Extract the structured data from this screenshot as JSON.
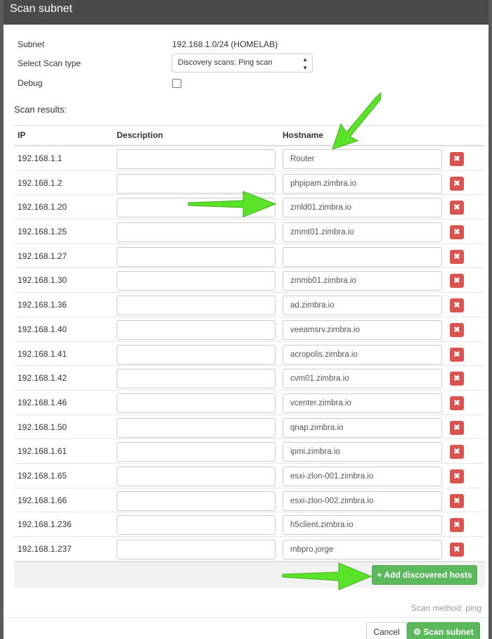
{
  "header": {
    "title": "Scan subnet"
  },
  "info": {
    "subnet_label": "Subnet",
    "subnet_value": "192.168.1.0/24 (HOMELAB)",
    "scan_type_label": "Select Scan type",
    "scan_type_value": "Discovery scans: Ping scan",
    "debug_label": "Debug"
  },
  "results_label": "Scan results:",
  "table": {
    "columns": [
      "IP",
      "Description",
      "Hostname"
    ],
    "rows": [
      {
        "ip": "192.168.1.1",
        "hostname": "Router"
      },
      {
        "ip": "192.168.1.2",
        "hostname": "phpipam.zimbra.io"
      },
      {
        "ip": "192.168.1.20",
        "hostname": "zmld01.zimbra.io"
      },
      {
        "ip": "192.168.1.25",
        "hostname": "zmmt01.zimbra.io"
      },
      {
        "ip": "192.168.1.27",
        "hostname": ""
      },
      {
        "ip": "192.168.1.30",
        "hostname": "zmmb01.zimbra.io"
      },
      {
        "ip": "192.168.1.36",
        "hostname": "ad.zimbra.io"
      },
      {
        "ip": "192.168.1.40",
        "hostname": "veeamsrv.zimbra.io"
      },
      {
        "ip": "192.168.1.41",
        "hostname": "acropolis.zimbra.io"
      },
      {
        "ip": "192.168.1.42",
        "hostname": "cvm01.zimbra.io"
      },
      {
        "ip": "192.168.1.46",
        "hostname": "vcenter.zimbra.io"
      },
      {
        "ip": "192.168.1.50",
        "hostname": "qnap.zimbra.io"
      },
      {
        "ip": "192.168.1.61",
        "hostname": "ipmi.zimbra.io"
      },
      {
        "ip": "192.168.1.65",
        "hostname": "esxi-zlon-001.zimbra.io"
      },
      {
        "ip": "192.168.1.66",
        "hostname": "esxi-zlon-002.zimbra.io"
      },
      {
        "ip": "192.168.1.236",
        "hostname": "h5client.zimbra.io"
      },
      {
        "ip": "192.168.1.237",
        "hostname": "mbpro.jorge"
      }
    ],
    "delete_glyph": "✖",
    "add_button_label": "+ Add discovered hosts"
  },
  "scan_method": "Scan method: ping",
  "footer": {
    "cancel_label": "Cancel",
    "scan_label": "Scan subnet",
    "scan_icon": "gears-icon"
  },
  "colors": {
    "header_bg": "#4a4a4a",
    "success": "#5cb85c",
    "danger": "#d9534f",
    "arrow": "#5be32a"
  }
}
